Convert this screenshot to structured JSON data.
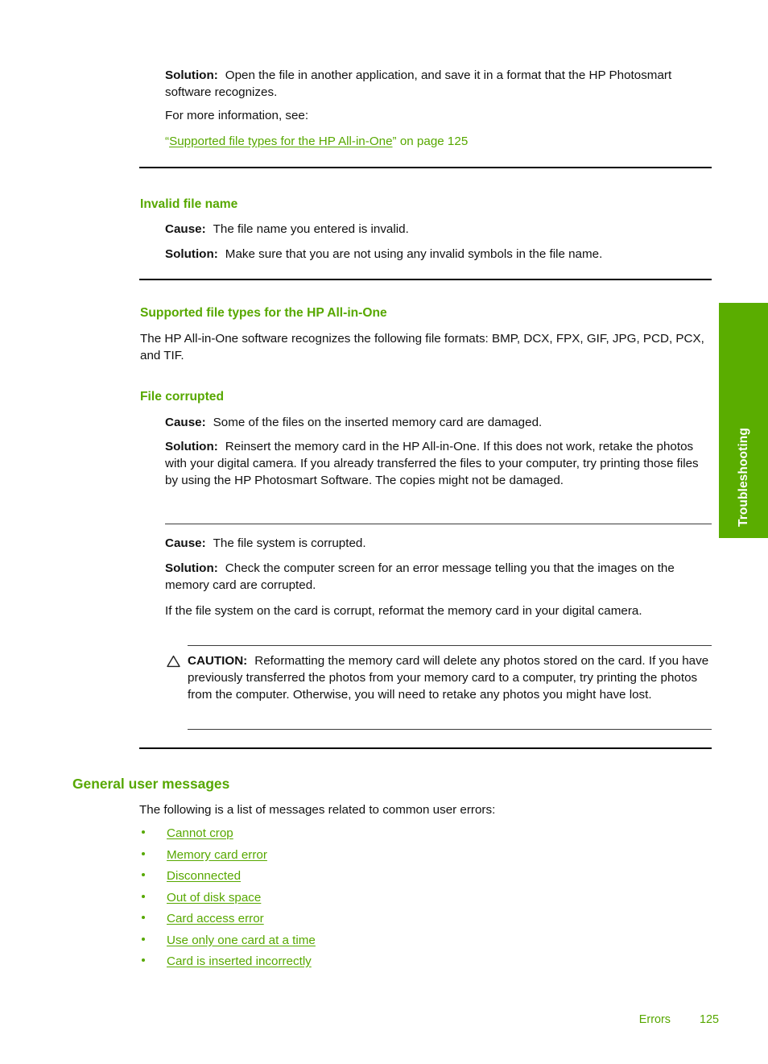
{
  "document": {
    "side_tab_label": "Troubleshooting",
    "accent_color": "#57a800",
    "tab_color": "#5aad00"
  },
  "sections": {
    "intro_solution": {
      "lead": "Solution:",
      "text": "Open the file in another application, and save it in a format that the HP Photosmart software recognizes.",
      "more_info": "For more information, see:",
      "link_open_quote": "“",
      "link_text": "Supported file types for the HP All-in-One",
      "link_close_quote": "”",
      "link_suffix": " on page 125"
    },
    "invalid_file_name": {
      "heading": "Invalid file name",
      "cause_lead": "Cause:",
      "cause_text": "The file name you entered is invalid.",
      "solution_lead": "Solution:",
      "solution_text": "Make sure that you are not using any invalid symbols in the file name."
    },
    "supported_file_types": {
      "heading": "Supported file types for the HP All-in-One",
      "text": "The HP All-in-One software recognizes the following file formats: BMP, DCX, FPX, GIF, JPG, PCD, PCX, and TIF."
    },
    "file_corrupted": {
      "heading": "File corrupted",
      "first": {
        "cause_lead": "Cause:",
        "cause_text": "Some of the files on the inserted memory card are damaged.",
        "solution_lead": "Solution:",
        "solution_text": "Reinsert the memory card in the HP All-in-One. If this does not work, retake the photos with your digital camera. If you already transferred the files to your computer, try printing those files by using the HP Photosmart Software. The copies might not be damaged."
      },
      "second": {
        "cause_lead": "Cause:",
        "cause_text": "The file system is corrupted.",
        "solution_lead": "Solution:",
        "solution_text": "Check the computer screen for an error message telling you that the images on the memory card are corrupted.",
        "extra_text": "If the file system on the card is corrupt, reformat the memory card in your digital camera."
      },
      "caution": {
        "icon": "warning-triangle-icon",
        "lead": "CAUTION:",
        "text": "Reformatting the memory card will delete any photos stored on the card. If you have previously transferred the photos from your memory card to a computer, try printing the photos from the computer. Otherwise, you will need to retake any photos you might have lost."
      }
    },
    "general_user_messages": {
      "heading": "General user messages",
      "intro": "The following is a list of messages related to common user errors:",
      "links": [
        "Cannot crop",
        "Memory card error",
        "Disconnected",
        "Out of disk space",
        "Card access error",
        "Use only one card at a time",
        "Card is inserted incorrectly"
      ]
    }
  },
  "footer": {
    "label": "Errors",
    "page_number": "125"
  }
}
